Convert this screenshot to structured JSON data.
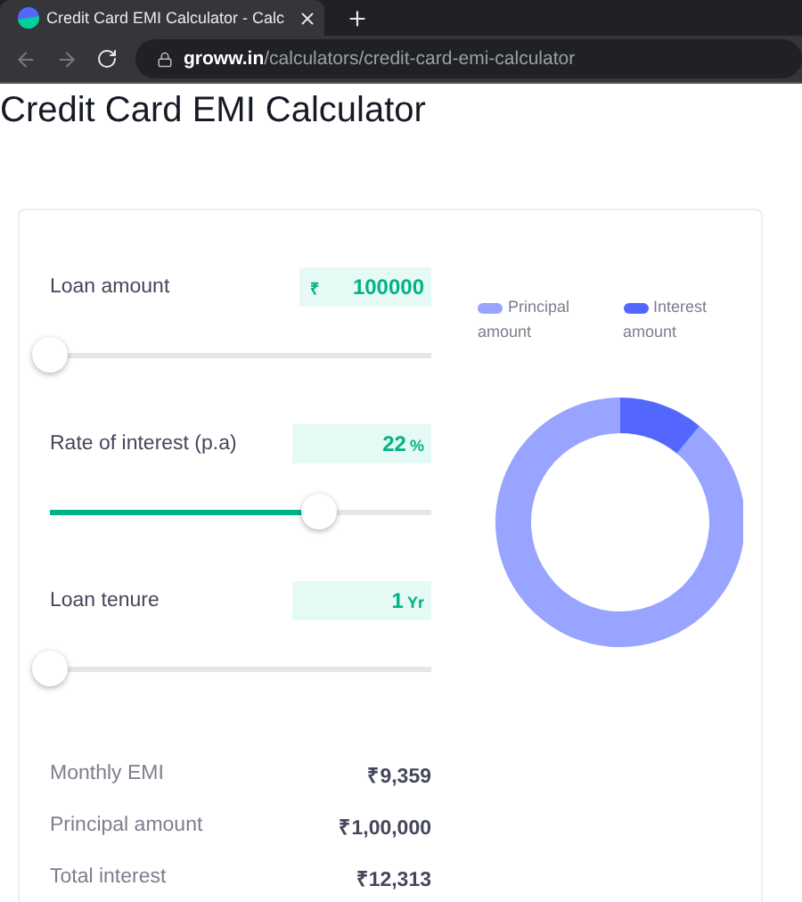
{
  "browser": {
    "tab_title": "Credit Card EMI Calculator - Calc",
    "url": "**groww.in**/calculators/credit-card-emi-calculator"
  },
  "page": {
    "title": "Credit Card EMI Calculator"
  },
  "inputs": [
    {
      "label": "Loan amount",
      "prefix": "₹",
      "value": "100000",
      "level": 0
    },
    {
      "label": "Rate of interest (p.a)",
      "value": "22",
      "suffix": "%",
      "level": 0.705
    },
    {
      "label": "Loan tenure",
      "value": "1",
      "suffix": "Yr",
      "level": 0
    }
  ],
  "legend": [
    {
      "color": "#98a4ff"
    },
    {
      "color": "#5367ff"
    }
  ],
  "chart_data": {
    "type": "donut",
    "categories": [
      "Principal amount",
      "Interest amount"
    ],
    "values": [
      89.04,
      10.96
    ]
  },
  "results": [
    {
      "label": "Monthly EMI",
      "value": "₹9,359"
    },
    {
      "label": "Principal amount",
      "value": "₹1,00,000"
    },
    {
      "label": "Total interest",
      "value": "₹12,313"
    }
  ]
}
